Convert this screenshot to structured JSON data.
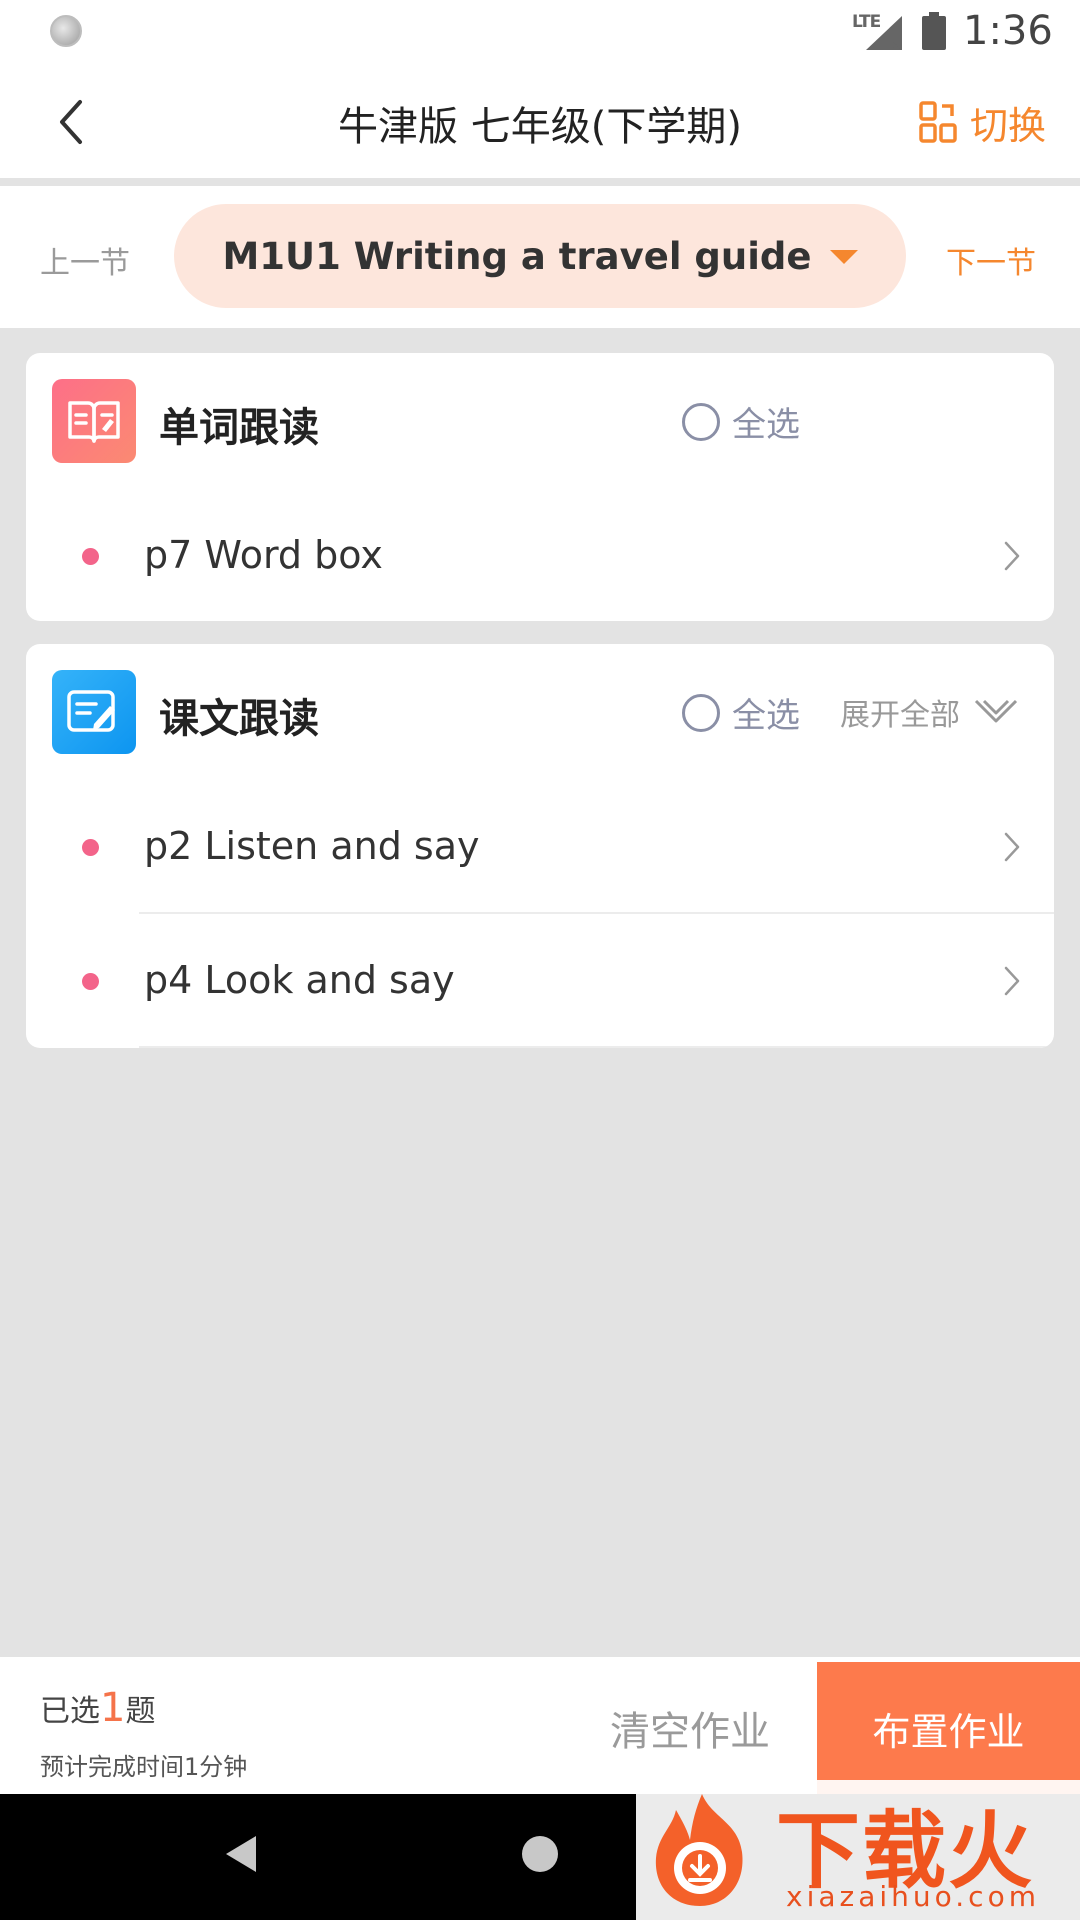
{
  "status_bar": {
    "network": "LTE",
    "time": "1:36"
  },
  "header": {
    "title": "牛津版 七年级(下学期)",
    "switch_label": "切换",
    "back_icon": "chevron-left-icon"
  },
  "section_nav": {
    "prev_label": "上一节",
    "next_label": "下一节",
    "current": "M1U1 Writing a travel guide"
  },
  "cards": [
    {
      "title": "单词跟读",
      "select_all_label": "全选",
      "items": [
        {
          "label": "p7 Word box"
        }
      ]
    },
    {
      "title": "课文跟读",
      "select_all_label": "全选",
      "expand_label": "展开全部",
      "items": [
        {
          "label": "p2 Listen and say"
        },
        {
          "label": "p4 Look and say"
        }
      ]
    }
  ],
  "bottom_bar": {
    "selected_prefix": "已选",
    "selected_count": "1",
    "selected_suffix": "题",
    "estimated_time": "预计完成时间1分钟",
    "clear_label": "清空作业",
    "assign_label": "布置作业"
  },
  "watermark": {
    "brand": "下载火",
    "domain": "xiazaihuo.com"
  },
  "colors": {
    "accent": "#f5872e",
    "primary_button": "#fd7a4c",
    "item_dot": "#f3648a",
    "pill_bg": "#fde6dc"
  }
}
